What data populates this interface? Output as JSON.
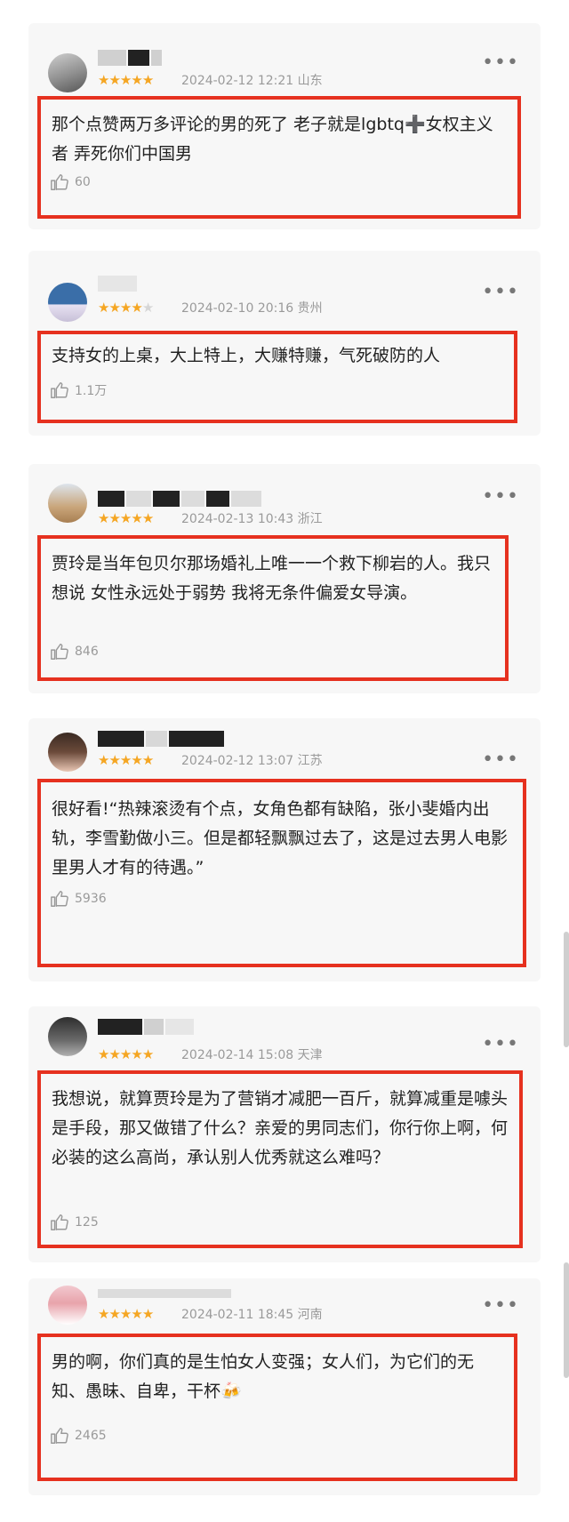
{
  "reviews": [
    {
      "stars": 5,
      "date": "2024-02-12",
      "time": "12:21",
      "location": "山东",
      "text": "那个点赞两万多评论的男的死了 老子就是lgbtq➕女权主义者 弄死你们中国男",
      "likes": "60"
    },
    {
      "stars": 4,
      "date": "2024-02-10",
      "time": "20:16",
      "location": "贵州",
      "text": "支持女的上桌，大上特上，大赚特赚，气死破防的人",
      "likes": "1.1万"
    },
    {
      "stars": 5,
      "date": "2024-02-13",
      "time": "10:43",
      "location": "浙江",
      "text": "贾玲是当年包贝尔那场婚礼上唯一一个救下柳岩的人。我只想说 女性永远处于弱势 我将无条件偏爱女导演。",
      "likes": "846"
    },
    {
      "stars": 5,
      "date": "2024-02-12",
      "time": "13:07",
      "location": "江苏",
      "text": "很好看!“热辣滚烫有个点，女角色都有缺陷，张小斐婚内出轨，李雪勤做小三。但是都轻飘飘过去了，这是过去男人电影里男人才有的待遇。”",
      "likes": "5936"
    },
    {
      "stars": 5,
      "date": "2024-02-14",
      "time": "15:08",
      "location": "天津",
      "text": "我想说，就算贾玲是为了营销才减肥一百斤，就算减重是噱头是手段，那又做错了什么？亲爱的男同志们，你行你上啊，何必装的这么高尚，承认别人优秀就这么难吗？",
      "likes": "125"
    },
    {
      "stars": 5,
      "date": "2024-02-11",
      "time": "18:45",
      "location": "河南",
      "text": "男的啊，你们真的是生怕女人变强；女人们，为它们的无知、愚昧、自卑，干杯🍻",
      "likes": "2465"
    }
  ],
  "icons": {
    "more": "more-horizontal-icon",
    "like": "thumbs-up-icon",
    "star": "star-icon"
  },
  "colors": {
    "highlight_box": "#e6311f",
    "star": "#f5a623",
    "card_bg": "#f7f7f7"
  }
}
